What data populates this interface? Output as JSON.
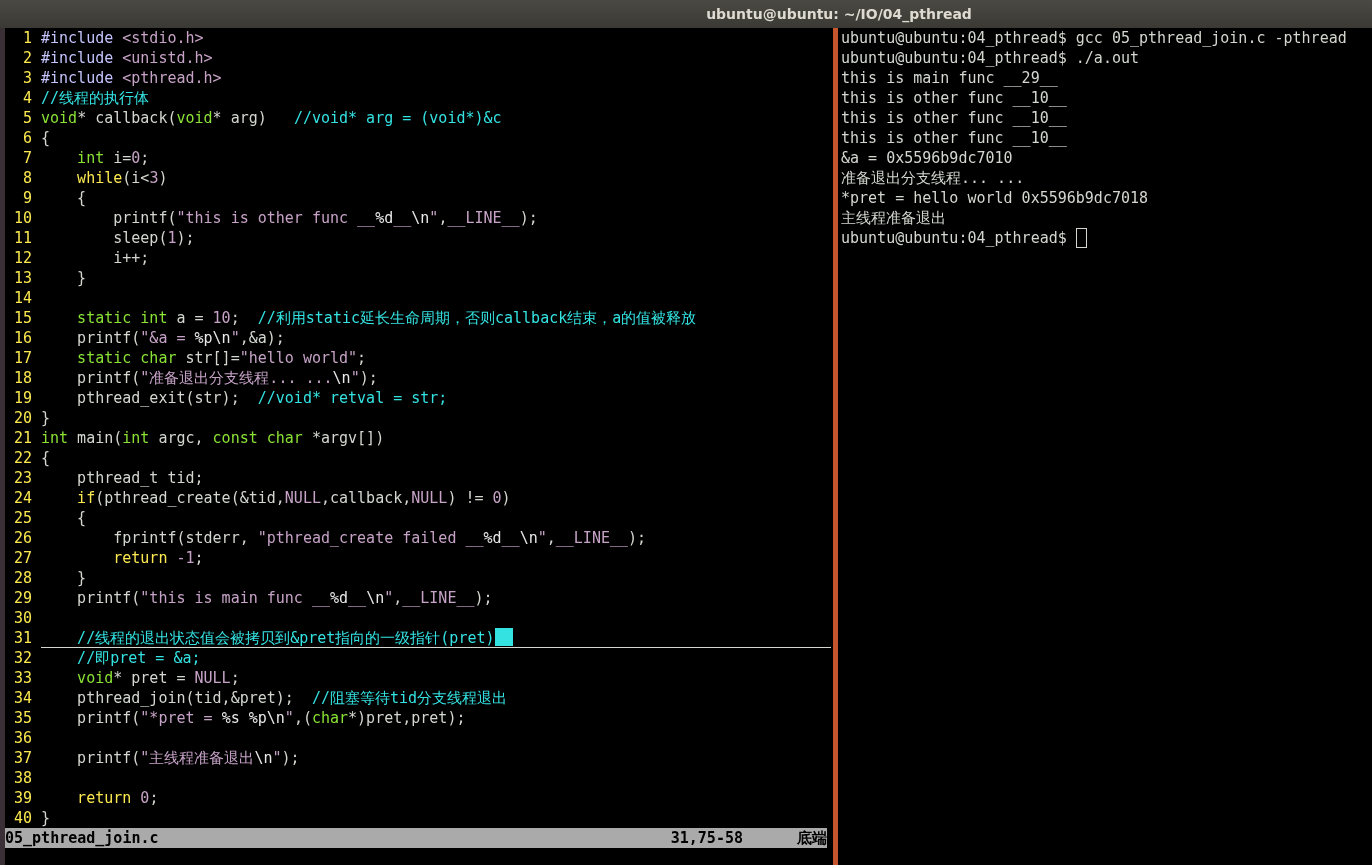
{
  "window": {
    "title": "ubuntu@ubuntu: ~/IO/04_pthread"
  },
  "editor": {
    "lines": [
      {
        "number": "1",
        "cursor": false,
        "tokens": [
          {
            "kind": "preproc",
            "text": "#include "
          },
          {
            "kind": "string",
            "text": "<stdio.h>"
          }
        ]
      },
      {
        "number": "2",
        "cursor": false,
        "tokens": [
          {
            "kind": "preproc",
            "text": "#include "
          },
          {
            "kind": "string",
            "text": "<unistd.h>"
          }
        ]
      },
      {
        "number": "3",
        "cursor": false,
        "tokens": [
          {
            "kind": "preproc",
            "text": "#include "
          },
          {
            "kind": "string",
            "text": "<pthread.h>"
          }
        ]
      },
      {
        "number": "4",
        "cursor": false,
        "tokens": [
          {
            "kind": "comment",
            "text": "//线程的执行体"
          }
        ]
      },
      {
        "number": "5",
        "cursor": false,
        "tokens": [
          {
            "kind": "type",
            "text": "void"
          },
          {
            "kind": "plain",
            "text": "* callback("
          },
          {
            "kind": "type",
            "text": "void"
          },
          {
            "kind": "plain",
            "text": "* arg)   "
          },
          {
            "kind": "comment",
            "text": "//void* arg = (void*)&c"
          }
        ]
      },
      {
        "number": "6",
        "cursor": false,
        "tokens": [
          {
            "kind": "plain",
            "text": "{"
          }
        ]
      },
      {
        "number": "7",
        "cursor": false,
        "tokens": [
          {
            "kind": "type",
            "text": "    int"
          },
          {
            "kind": "plain",
            "text": " i="
          },
          {
            "kind": "number",
            "text": "0"
          },
          {
            "kind": "plain",
            "text": ";"
          }
        ]
      },
      {
        "number": "8",
        "cursor": false,
        "tokens": [
          {
            "kind": "keyword",
            "text": "    while"
          },
          {
            "kind": "plain",
            "text": "(i<"
          },
          {
            "kind": "number",
            "text": "3"
          },
          {
            "kind": "plain",
            "text": ")"
          }
        ]
      },
      {
        "number": "9",
        "cursor": false,
        "tokens": [
          {
            "kind": "plain",
            "text": "    {"
          }
        ]
      },
      {
        "number": "10",
        "cursor": false,
        "tokens": [
          {
            "kind": "plain",
            "text": "        printf("
          },
          {
            "kind": "string",
            "text": "\"this is other func __"
          },
          {
            "kind": "special",
            "text": "%d"
          },
          {
            "kind": "string",
            "text": "__"
          },
          {
            "kind": "special",
            "text": "\\n"
          },
          {
            "kind": "string",
            "text": "\""
          },
          {
            "kind": "plain",
            "text": ","
          },
          {
            "kind": "constant",
            "text": "__LINE__"
          },
          {
            "kind": "plain",
            "text": ");"
          }
        ]
      },
      {
        "number": "11",
        "cursor": false,
        "tokens": [
          {
            "kind": "plain",
            "text": "        sleep("
          },
          {
            "kind": "number",
            "text": "1"
          },
          {
            "kind": "plain",
            "text": ");"
          }
        ]
      },
      {
        "number": "12",
        "cursor": false,
        "tokens": [
          {
            "kind": "plain",
            "text": "        i++;"
          }
        ]
      },
      {
        "number": "13",
        "cursor": false,
        "tokens": [
          {
            "kind": "plain",
            "text": "    }"
          }
        ]
      },
      {
        "number": "14",
        "cursor": false
      },
      {
        "number": "15",
        "cursor": false,
        "tokens": [
          {
            "kind": "type",
            "text": "    static int"
          },
          {
            "kind": "plain",
            "text": " a = "
          },
          {
            "kind": "number",
            "text": "10"
          },
          {
            "kind": "plain",
            "text": ";  "
          },
          {
            "kind": "comment",
            "text": "//利用static延长生命周期，否则callback结束，a的值被释放"
          }
        ]
      },
      {
        "number": "16",
        "cursor": false,
        "tokens": [
          {
            "kind": "plain",
            "text": "    printf("
          },
          {
            "kind": "string",
            "text": "\"&a = "
          },
          {
            "kind": "special",
            "text": "%p\\n"
          },
          {
            "kind": "string",
            "text": "\""
          },
          {
            "kind": "plain",
            "text": ",&a);"
          }
        ]
      },
      {
        "number": "17",
        "cursor": false,
        "tokens": [
          {
            "kind": "type",
            "text": "    static char"
          },
          {
            "kind": "plain",
            "text": " str[]="
          },
          {
            "kind": "string",
            "text": "\"hello world\""
          },
          {
            "kind": "plain",
            "text": ";"
          }
        ]
      },
      {
        "number": "18",
        "cursor": false,
        "tokens": [
          {
            "kind": "plain",
            "text": "    printf("
          },
          {
            "kind": "string",
            "text": "\"准备退出分支线程... ..."
          },
          {
            "kind": "special",
            "text": "\\n"
          },
          {
            "kind": "string",
            "text": "\""
          },
          {
            "kind": "plain",
            "text": ");"
          }
        ]
      },
      {
        "number": "19",
        "cursor": false,
        "tokens": [
          {
            "kind": "plain",
            "text": "    pthread_exit(str);  "
          },
          {
            "kind": "comment",
            "text": "//void* retval = str;"
          }
        ]
      },
      {
        "number": "20",
        "cursor": false,
        "tokens": [
          {
            "kind": "plain",
            "text": "}"
          }
        ]
      },
      {
        "number": "21",
        "cursor": false,
        "tokens": [
          {
            "kind": "type",
            "text": "int"
          },
          {
            "kind": "plain",
            "text": " main("
          },
          {
            "kind": "type",
            "text": "int"
          },
          {
            "kind": "plain",
            "text": " argc, "
          },
          {
            "kind": "type",
            "text": "const char"
          },
          {
            "kind": "plain",
            "text": " *argv[])"
          }
        ]
      },
      {
        "number": "22",
        "cursor": false,
        "tokens": [
          {
            "kind": "plain",
            "text": "{"
          }
        ]
      },
      {
        "number": "23",
        "cursor": false,
        "tokens": [
          {
            "kind": "plain",
            "text": "    pthread_t tid;"
          }
        ]
      },
      {
        "number": "24",
        "cursor": false,
        "tokens": [
          {
            "kind": "keyword",
            "text": "    if"
          },
          {
            "kind": "plain",
            "text": "(pthread_create(&tid,"
          },
          {
            "kind": "constant",
            "text": "NULL"
          },
          {
            "kind": "plain",
            "text": ",callback,"
          },
          {
            "kind": "constant",
            "text": "NULL"
          },
          {
            "kind": "plain",
            "text": ") != "
          },
          {
            "kind": "number",
            "text": "0"
          },
          {
            "kind": "plain",
            "text": ")"
          }
        ]
      },
      {
        "number": "25",
        "cursor": false,
        "tokens": [
          {
            "kind": "plain",
            "text": "    {"
          }
        ]
      },
      {
        "number": "26",
        "cursor": false,
        "tokens": [
          {
            "kind": "plain",
            "text": "        fprintf(stderr, "
          },
          {
            "kind": "string",
            "text": "\"pthread_create failed __"
          },
          {
            "kind": "special",
            "text": "%d"
          },
          {
            "kind": "string",
            "text": "__"
          },
          {
            "kind": "special",
            "text": "\\n"
          },
          {
            "kind": "string",
            "text": "\""
          },
          {
            "kind": "plain",
            "text": ","
          },
          {
            "kind": "constant",
            "text": "__LINE__"
          },
          {
            "kind": "plain",
            "text": ");"
          }
        ]
      },
      {
        "number": "27",
        "cursor": false,
        "tokens": [
          {
            "kind": "keyword",
            "text": "        return"
          },
          {
            "kind": "number",
            "text": " -1"
          },
          {
            "kind": "plain",
            "text": ";"
          }
        ]
      },
      {
        "number": "28",
        "cursor": false,
        "tokens": [
          {
            "kind": "plain",
            "text": "    }"
          }
        ]
      },
      {
        "number": "29",
        "cursor": false,
        "tokens": [
          {
            "kind": "plain",
            "text": "    printf("
          },
          {
            "kind": "string",
            "text": "\"this is main func __"
          },
          {
            "kind": "special",
            "text": "%d"
          },
          {
            "kind": "string",
            "text": "__"
          },
          {
            "kind": "special",
            "text": "\\n"
          },
          {
            "kind": "string",
            "text": "\""
          },
          {
            "kind": "plain",
            "text": ","
          },
          {
            "kind": "constant",
            "text": "__LINE__"
          },
          {
            "kind": "plain",
            "text": ");"
          }
        ]
      },
      {
        "number": "30",
        "cursor": false
      },
      {
        "number": "31",
        "cursor": true,
        "tokens": [
          {
            "kind": "comment",
            "text": "    //线程的退出状态值会被拷贝到&pret指向的一级指针(pret)"
          }
        ]
      },
      {
        "number": "32",
        "cursor": false,
        "tokens": [
          {
            "kind": "comment",
            "text": "    //即pret = &a;"
          }
        ]
      },
      {
        "number": "33",
        "cursor": false,
        "tokens": [
          {
            "kind": "type",
            "text": "    void"
          },
          {
            "kind": "plain",
            "text": "* pret = "
          },
          {
            "kind": "constant",
            "text": "NULL"
          },
          {
            "kind": "plain",
            "text": ";"
          }
        ]
      },
      {
        "number": "34",
        "cursor": false,
        "tokens": [
          {
            "kind": "plain",
            "text": "    pthread_join(tid,&pret);  "
          },
          {
            "kind": "comment",
            "text": "//阻塞等待tid分支线程退出"
          }
        ]
      },
      {
        "number": "35",
        "cursor": false,
        "tokens": [
          {
            "kind": "plain",
            "text": "    printf("
          },
          {
            "kind": "string",
            "text": "\"*pret = "
          },
          {
            "kind": "special",
            "text": "%s %p\\n"
          },
          {
            "kind": "string",
            "text": "\""
          },
          {
            "kind": "plain",
            "text": ",("
          },
          {
            "kind": "type",
            "text": "char"
          },
          {
            "kind": "plain",
            "text": "*)pret,pret);"
          }
        ]
      },
      {
        "number": "36",
        "cursor": false
      },
      {
        "number": "37",
        "cursor": false,
        "tokens": [
          {
            "kind": "plain",
            "text": "    printf("
          },
          {
            "kind": "string",
            "text": "\"主线程准备退出"
          },
          {
            "kind": "special",
            "text": "\\n"
          },
          {
            "kind": "string",
            "text": "\""
          },
          {
            "kind": "plain",
            "text": ");"
          }
        ]
      },
      {
        "number": "38",
        "cursor": false
      },
      {
        "number": "39",
        "cursor": false,
        "tokens": [
          {
            "kind": "keyword",
            "text": "    return"
          },
          {
            "kind": "number",
            "text": " 0"
          },
          {
            "kind": "plain",
            "text": ";"
          }
        ]
      },
      {
        "number": "40",
        "cursor": false,
        "tokens": [
          {
            "kind": "plain",
            "text": "}"
          }
        ]
      }
    ],
    "status_bar": {
      "file": "05_pthread_join.c",
      "position": "31,75-58",
      "scroll": "底端"
    }
  },
  "terminal": {
    "lines": [
      {
        "text": "ubuntu@ubuntu:04_pthread$ gcc 05_pthread_join.c -pthread",
        "cursor": false
      },
      {
        "text": "ubuntu@ubuntu:04_pthread$ ./a.out",
        "cursor": false
      },
      {
        "text": "this is main func __29__",
        "cursor": false
      },
      {
        "text": "this is other func __10__",
        "cursor": false
      },
      {
        "text": "this is other func __10__",
        "cursor": false
      },
      {
        "text": "this is other func __10__",
        "cursor": false
      },
      {
        "text": "&a = 0x5596b9dc7010",
        "cursor": false
      },
      {
        "text": "准备退出分支线程... ...",
        "cursor": false
      },
      {
        "text": "*pret = hello world 0x5596b9dc7018",
        "cursor": false
      },
      {
        "text": "主线程准备退出",
        "cursor": false
      },
      {
        "text": "ubuntu@ubuntu:04_pthread$",
        "cursor": true
      }
    ]
  }
}
